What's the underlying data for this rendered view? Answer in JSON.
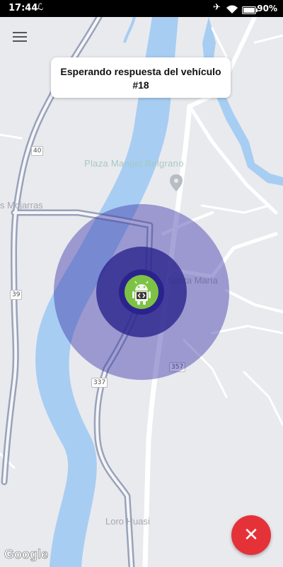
{
  "status_bar": {
    "time": "17:44",
    "battery": "90%",
    "icons": [
      "notification-icon",
      "airplane-icon",
      "wifi-icon",
      "battery-icon"
    ]
  },
  "header": {
    "menu_icon": "menu-icon"
  },
  "card": {
    "title": "Esperando respuesta del vehículo #18"
  },
  "map": {
    "poi": "Plaza Manuel Belgrano",
    "labels": {
      "mojarras": "s Mojarras",
      "santa_maria": "Santa María",
      "loro_huasi": "Loro Huasi"
    },
    "routes": {
      "r40": "40",
      "r39": "39",
      "r337": "337",
      "r357": "357"
    },
    "attribution": "Google",
    "colors": {
      "water": "#a7cdf2",
      "road": "#ffffff",
      "land": "#e9eaee"
    }
  },
  "marker": {
    "icon": "android-icon",
    "color": "#7dc244"
  },
  "pulse": {
    "color": "#2b238d"
  },
  "fab": {
    "icon": "close-icon",
    "color": "#e53238"
  }
}
